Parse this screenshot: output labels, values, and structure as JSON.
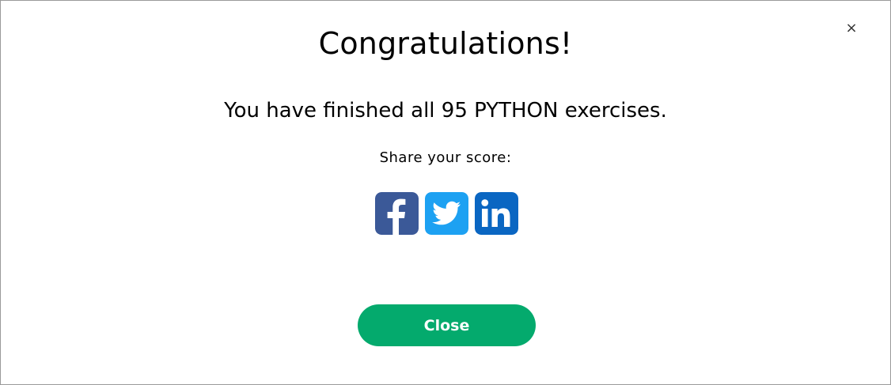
{
  "dialog": {
    "close_glyph": "×",
    "title": "Congratulations!",
    "message": "You have finished all 95 PYTHON exercises.",
    "share_label": "Share your score:",
    "share": [
      {
        "icon": "facebook-icon",
        "color": "#3b5998"
      },
      {
        "icon": "twitter-icon",
        "color": "#1da1f2"
      },
      {
        "icon": "linkedin-icon",
        "color": "#0a66c2"
      }
    ],
    "close_button_label": "Close",
    "close_button_color": "#04aa6d"
  }
}
